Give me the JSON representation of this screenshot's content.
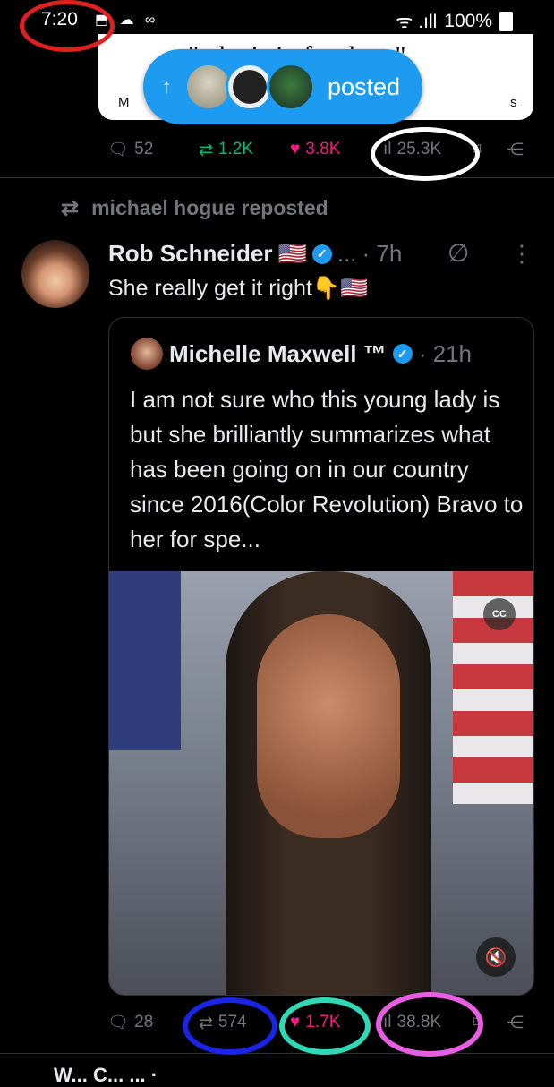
{
  "status_bar": {
    "time": "7:20",
    "left_icons": "⬒ ☁ ∞",
    "signal": "ᯤ .ıll",
    "battery": "100%"
  },
  "previous_post": {
    "quote_fragment": "\"...he is in for them\"",
    "sub_left": "M",
    "sub_right": "s",
    "new_posts_pill": {
      "arrow": "↑",
      "label": "posted"
    },
    "stats": {
      "replies": "52",
      "reposts": "1.2K",
      "likes": "3.8K",
      "views": "25.3K"
    }
  },
  "repost_line": {
    "label": "michael hogue reposted"
  },
  "post": {
    "author": "Rob Schneider",
    "author_flag": "🇺🇸",
    "ellipsis": "...",
    "time": "· 7h",
    "text": "She really get it right👇🇺🇸",
    "quoted": {
      "author": "Michelle Maxwell ™",
      "time": "· 21h",
      "text": "I am not sure who this young lady is but she brilliantly summarizes what has been going on in our country since 2016(Color Revolution) Bravo to her for spe...",
      "video": {
        "cc_label": "CC",
        "mute_icon": "speaker-muted-icon"
      }
    },
    "stats": {
      "replies": "28",
      "reposts": "574",
      "likes": "1.7K",
      "views": "38.8K"
    }
  },
  "next_post": {
    "author_partial": "W... C... ... ·"
  },
  "colors": {
    "accent": "#1d9bf0",
    "repost": "#00ba7c",
    "like": "#f91880",
    "muted": "#71767b"
  }
}
